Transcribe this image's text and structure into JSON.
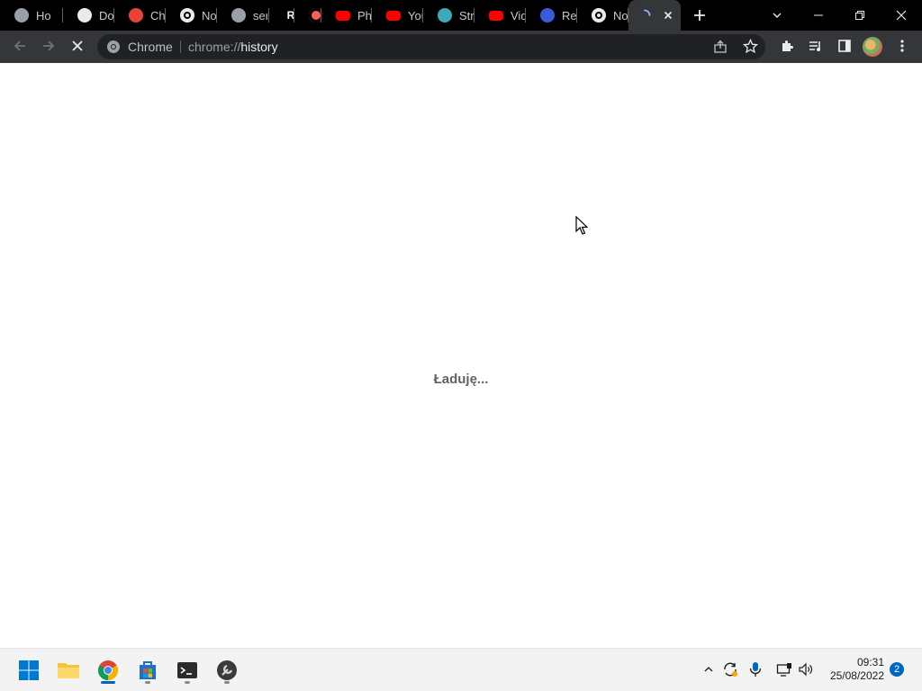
{
  "tabs": [
    {
      "title": "Ho",
      "favicon": "roblox-icon",
      "color": "#9aa0a6"
    },
    {
      "title": "Do",
      "favicon": "globe-icon",
      "color": "#e8eaed"
    },
    {
      "title": "Chr",
      "favicon": "chrome-web-store-icon",
      "color": "#ea4335"
    },
    {
      "title": "No",
      "favicon": "chrome-icon",
      "color": "#e8eaed"
    },
    {
      "title": "ser",
      "favicon": "globe-icon",
      "color": "#9aa0a6"
    },
    {
      "title": "",
      "favicon": "R",
      "color": "#ffffff"
    },
    {
      "title": "",
      "favicon": "record-icon",
      "color": "#ff5c5c"
    },
    {
      "title": "Pho",
      "favicon": "youtube-icon",
      "color": "#ff0000"
    },
    {
      "title": "You",
      "favicon": "youtube-icon",
      "color": "#ff0000"
    },
    {
      "title": "Stre",
      "favicon": "stream-icon",
      "color": "#3fa9b5"
    },
    {
      "title": "Vid",
      "favicon": "youtube-icon",
      "color": "#ff0000"
    },
    {
      "title": "Reg",
      "favicon": "bb-icon",
      "color": "#3a5cd8"
    },
    {
      "title": "No",
      "favicon": "chrome-icon",
      "color": "#e8eaed"
    }
  ],
  "active_tab": {
    "title": "",
    "favicon": "loading-spinner-icon"
  },
  "omnibox": {
    "site_label": "Chrome",
    "url_scheme": "chrome://",
    "url_host": "history"
  },
  "page": {
    "loading_text": "Ładuję..."
  },
  "taskbar": {
    "time": "09:31",
    "date": "25/08/2022",
    "notification_count": "2"
  },
  "colors": {
    "accent": "#0067c0",
    "toolbar": "#35363a",
    "tabstrip": "#000000",
    "omnibox": "#202124"
  }
}
